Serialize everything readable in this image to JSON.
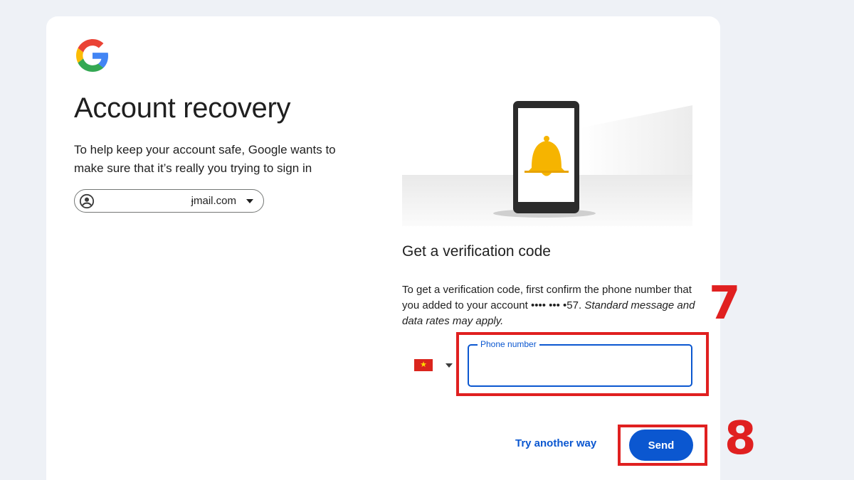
{
  "header": {
    "logo_name": "google-g-logo",
    "title": "Account recovery",
    "subtitle": "To help keep your account safe, Google wants to make sure that it’s really you trying to sign in"
  },
  "account": {
    "email": "ɉmail.com",
    "avatar_icon": "account-circle-icon",
    "chevron_icon": "chevron-down-icon"
  },
  "verification": {
    "title": "Get a verification code",
    "description_plain": "To get a verification code, first confirm the phone number that you added to your account •••• ••• •57. ",
    "description_italic": "Standard message and data rates may apply.",
    "country": {
      "selected": "Vietnam",
      "flag_icon": "vietnam-flag-icon",
      "caret_icon": "caret-down-icon"
    },
    "phone_field": {
      "label": "Phone number",
      "value": ""
    }
  },
  "actions": {
    "try_another_way": "Try another way",
    "send": "Send"
  },
  "annotations": {
    "step_7": "7",
    "step_8": "8",
    "highlight_color": "#e02020"
  },
  "colors": {
    "primary_blue": "#0b57d0",
    "background": "#eef1f6",
    "bell": "#f6b400"
  }
}
